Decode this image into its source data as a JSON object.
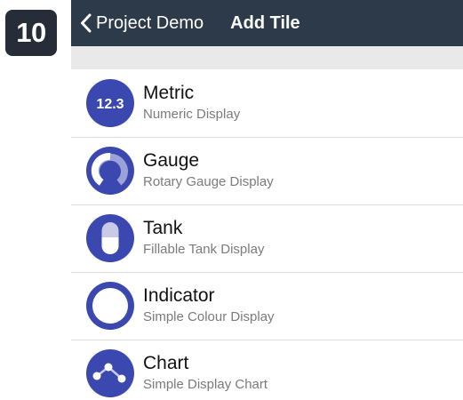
{
  "step": {
    "number": "10"
  },
  "nav": {
    "back_label": "Project Demo",
    "title": "Add Tile"
  },
  "colors": {
    "nav_bar": "#2d3a4a",
    "badge": "#262c38",
    "icon_circle": "#3a48b0",
    "section_header": "#e9e9ea"
  },
  "tiles": [
    {
      "name": "Metric",
      "description": "Numeric Display",
      "icon": "metric-icon",
      "icon_text": "12.3"
    },
    {
      "name": "Gauge",
      "description": "Rotary Gauge Display",
      "icon": "gauge-icon"
    },
    {
      "name": "Tank",
      "description": "Fillable Tank Display",
      "icon": "tank-icon"
    },
    {
      "name": "Indicator",
      "description": "Simple Colour Display",
      "icon": "indicator-icon"
    },
    {
      "name": "Chart",
      "description": "Simple Display Chart",
      "icon": "chart-icon"
    }
  ]
}
